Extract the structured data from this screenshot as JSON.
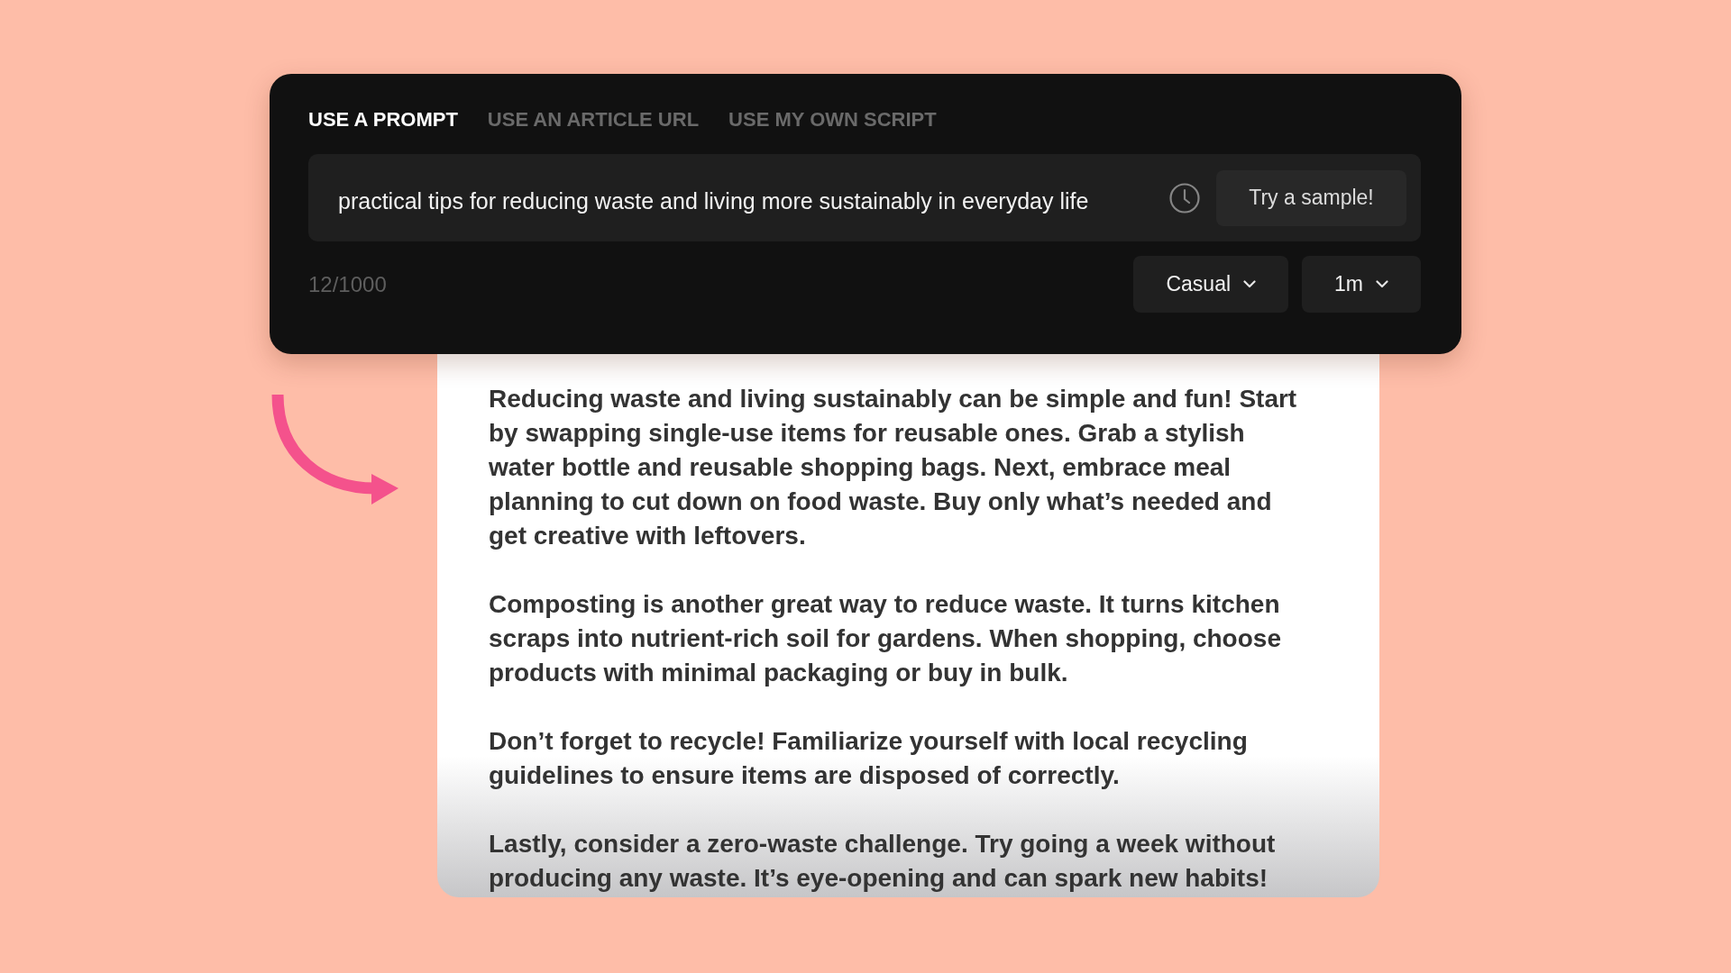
{
  "tabs": [
    {
      "label": "USE A PROMPT",
      "selected": true
    },
    {
      "label": "USE AN ARTICLE URL",
      "selected": false
    },
    {
      "label": "USE MY OWN SCRIPT",
      "selected": false
    }
  ],
  "prompt": {
    "value": "practical tips for reducing waste and living more sustainably in everyday life",
    "sample_button": "Try a sample!"
  },
  "counter": "12/1000",
  "dropdowns": [
    {
      "value": "Casual"
    },
    {
      "value": "1m"
    }
  ],
  "script": {
    "paragraphs": [
      "Reducing waste and living sustainably can be simple and fun! Start by swapping single-use items for reusable ones. Grab a stylish water bottle and reusable shopping bags. Next, embrace meal planning to cut down on food waste. Buy only what’s needed and get creative with leftovers.",
      "Composting is another great way to reduce waste. It turns kitchen scraps into nutrient-rich soil for gardens. When shopping, choose products with minimal packaging or buy in bulk.",
      "Don’t forget to recycle! Familiarize yourself with local recycling guidelines to ensure items are disposed of correctly.",
      "Lastly, consider a zero-waste challenge. Try going a week without producing any waste. It’s eye-opening and can spark new habits!"
    ]
  }
}
